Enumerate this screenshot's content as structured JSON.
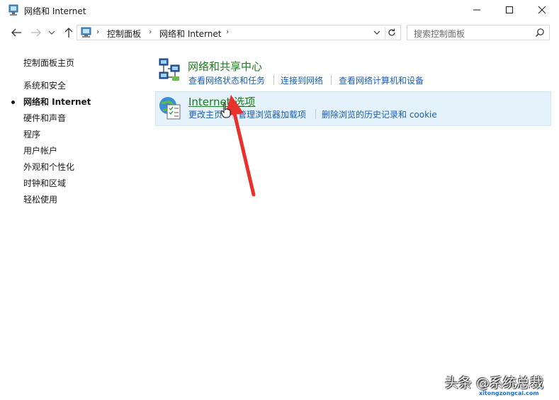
{
  "window": {
    "title": "网络和 Internet"
  },
  "nav": {
    "breadcrumbs": [
      "控制面板",
      "网络和 Internet"
    ],
    "search_placeholder": "搜索控制面板"
  },
  "sidebar": {
    "items": [
      {
        "label": "控制面板主页",
        "active": false
      },
      {
        "label": "系统和安全",
        "active": false
      },
      {
        "label": "网络和 Internet",
        "active": true
      },
      {
        "label": "硬件和声音",
        "active": false
      },
      {
        "label": "程序",
        "active": false
      },
      {
        "label": "用户帐户",
        "active": false
      },
      {
        "label": "外观和个性化",
        "active": false
      },
      {
        "label": "时钟和区域",
        "active": false
      },
      {
        "label": "轻松使用",
        "active": false
      }
    ]
  },
  "categories": [
    {
      "title": "网络和共享中心",
      "icon": "network-sharing-icon",
      "links": [
        "查看网络状态和任务",
        "连接到网络",
        "查看网络计算机和设备"
      ]
    },
    {
      "title": "Internet 选项",
      "icon": "internet-options-icon",
      "links": [
        "更改主页",
        "管理浏览器加载项",
        "删除浏览的历史记录和 cookie"
      ]
    }
  ],
  "watermark": {
    "text": "头条 @系统总裁",
    "url": "xitongzongcai.com"
  },
  "colors": {
    "category_title": "#1e7a1e",
    "link": "#1a5fb4",
    "hover_bg": "#e5f1fb",
    "annotation_arrow": "#e8302c"
  }
}
